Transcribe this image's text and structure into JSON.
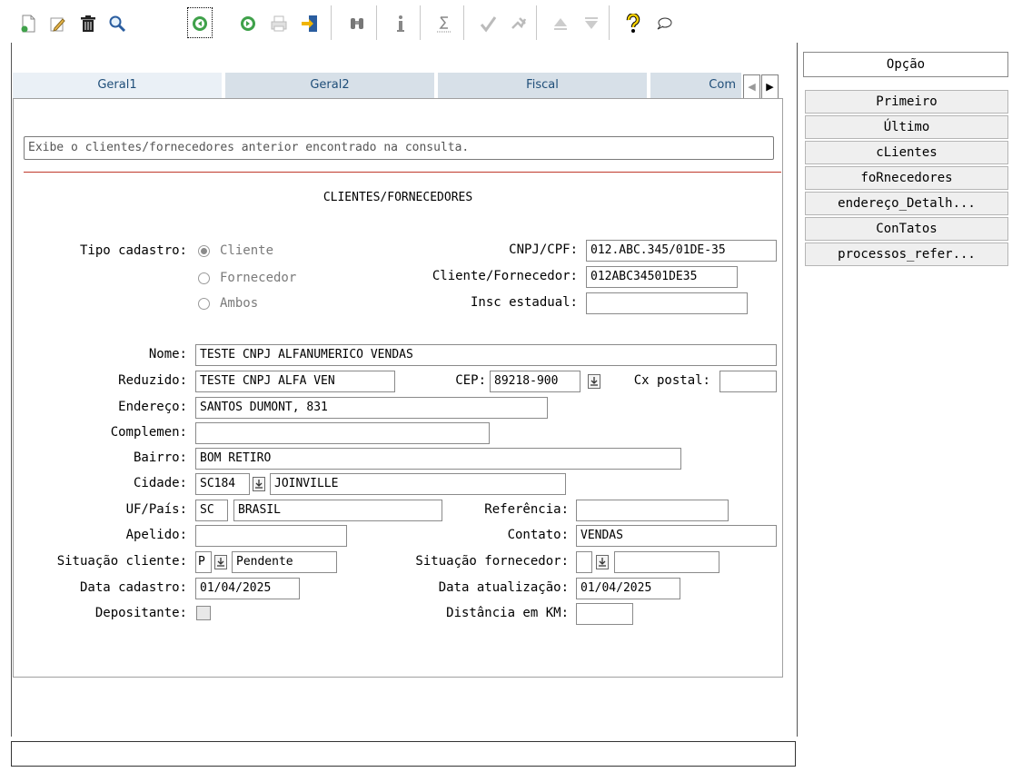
{
  "tabs": [
    "Geral1",
    "Geral2",
    "Fiscal",
    "Com"
  ],
  "tab_nav": {
    "prev": "◀",
    "next": "▶"
  },
  "hint": "Exibe o clientes/fornecedores anterior encontrado na consulta.",
  "form_title": "CLIENTES/FORNECEDORES",
  "labels": {
    "tipo": "Tipo cadastro:",
    "cnpj": "CNPJ/CPF:",
    "clifor": "Cliente/Fornecedor:",
    "insc": "Insc estadual:",
    "nome": "Nome:",
    "reduzido": "Reduzido:",
    "cep": "CEP:",
    "cxpostal": "Cx postal:",
    "endereco": "Endereço:",
    "complemen": "Complemen:",
    "bairro": "Bairro:",
    "cidade": "Cidade:",
    "ufpais": "UF/País:",
    "referencia": "Referência:",
    "apelido": "Apelido:",
    "contato": "Contato:",
    "sitcli": "Situação cliente:",
    "sitforn": "Situação fornecedor:",
    "datacad": "Data cadastro:",
    "dataatu": "Data atualização:",
    "depositante": "Depositante:",
    "distancia": "Distância em KM:"
  },
  "radios": {
    "cliente": "Cliente",
    "fornecedor": "Fornecedor",
    "ambos": "Ambos",
    "selected": "Cliente"
  },
  "values": {
    "cnpj": "012.ABC.345/01DE-35",
    "clifor": "012ABC34501DE35",
    "insc": "",
    "nome": "TESTE CNPJ ALFANUMERICO VENDAS",
    "reduzido": "TESTE CNPJ ALFA VEN",
    "cep": "89218-900",
    "cxpostal": "",
    "endereco": "SANTOS DUMONT, 831",
    "complemen": "",
    "bairro": "BOM RETIRO",
    "cidade_code": "SC184",
    "cidade": "JOINVILLE",
    "uf": "SC",
    "pais": "BRASIL",
    "referencia": "",
    "apelido": "",
    "contato": "VENDAS",
    "sitcli_code": "P",
    "sitcli": "Pendente",
    "sitforn_code": "",
    "sitforn": "",
    "datacad": "01/04/2025",
    "dataatu": "01/04/2025",
    "distancia": ""
  },
  "side": {
    "opcao": "Opção",
    "buttons": [
      "Primeiro",
      "Último",
      "cLientes",
      "foRnecedores",
      "endereço_Detalh...",
      "ConTatos",
      "processos_refer..."
    ]
  },
  "colors": {
    "tab_text": "#1f4e79",
    "separator_red": "#c0392b",
    "tab_active": "#eaf0f6",
    "tab_inactive": "#d7e0e8"
  }
}
